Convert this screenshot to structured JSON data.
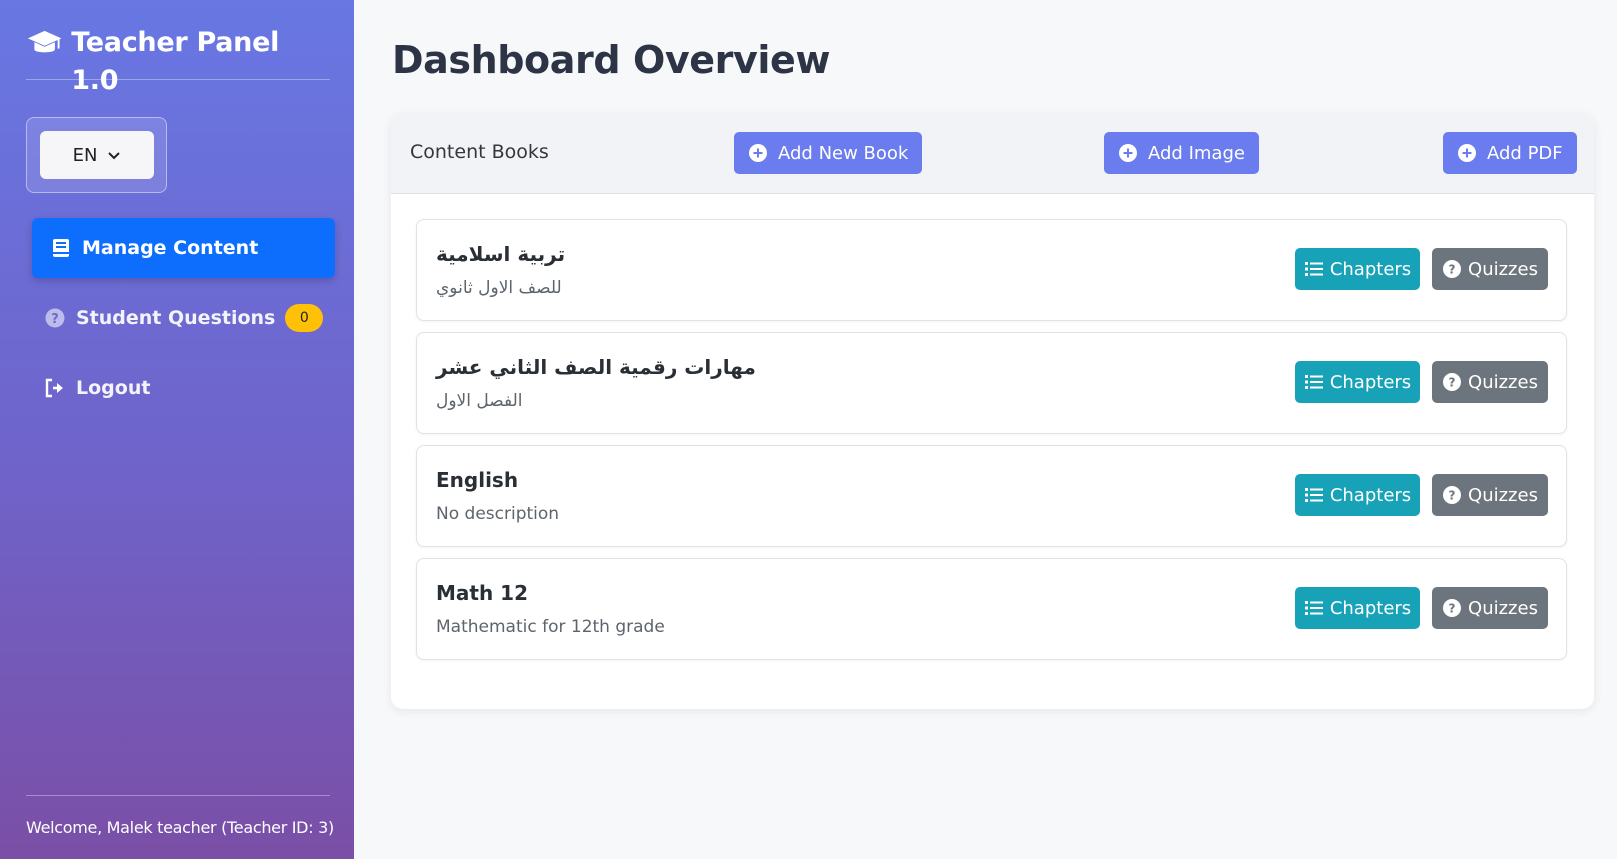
{
  "brand": {
    "title": "Teacher Panel 1.0",
    "icon": "graduation-cap-icon"
  },
  "language": {
    "selected": "EN"
  },
  "nav": {
    "manage_content": "Manage Content",
    "student_questions": "Student Questions",
    "student_questions_count": "0",
    "logout": "Logout"
  },
  "footer": {
    "welcome": "Welcome, Malek teacher (Teacher ID: 3)"
  },
  "page": {
    "title": "Dashboard Overview"
  },
  "content": {
    "header_title": "Content Books",
    "add_book": "Add New Book",
    "add_image": "Add Image",
    "add_pdf": "Add PDF",
    "chapters_label": "Chapters",
    "quizzes_label": "Quizzes",
    "books": [
      {
        "title": "تربية اسلامية",
        "description": "للصف الاول ثانوي"
      },
      {
        "title": "مهارات رقمية الصف الثاني عشر",
        "description": "الفصل الاول"
      },
      {
        "title": "English",
        "description": "No description"
      },
      {
        "title": "Math 12",
        "description": "Mathematic for 12th grade"
      }
    ]
  },
  "colors": {
    "primary": "#0d6efd",
    "accent": "#6a7cee",
    "info": "#17a2b8",
    "secondary": "#6c757d",
    "warning": "#ffc107"
  }
}
